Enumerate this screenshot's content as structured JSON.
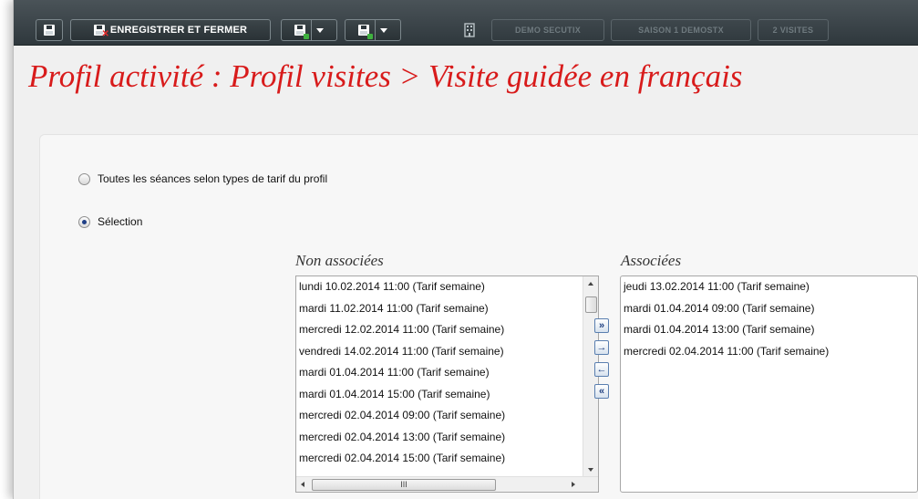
{
  "toolbar": {
    "save_and_close_label": "ENREGISTRER ET FERMER",
    "breadcrumb": [
      "DEMO SECUTIX",
      "SAISON 1 DEMOSTX",
      "2 VISITES"
    ]
  },
  "page": {
    "title": "Profil activité : Profil visites > Visite guidée en français"
  },
  "options": {
    "all_sessions_label": "Toutes les séances selon types de tarif du profil",
    "selection_label": "Sélection",
    "selected": "selection"
  },
  "lists": {
    "unassociated_title": "Non associées",
    "associated_title": "Associées",
    "unassociated": [
      "lundi 10.02.2014 11:00 (Tarif semaine)",
      "mardi 11.02.2014 11:00 (Tarif semaine)",
      "mercredi 12.02.2014 11:00 (Tarif semaine)",
      "vendredi 14.02.2014 11:00 (Tarif semaine)",
      "mardi 01.04.2014 11:00 (Tarif semaine)",
      "mardi 01.04.2014 15:00 (Tarif semaine)",
      "mercredi 02.04.2014 09:00 (Tarif semaine)",
      "mercredi 02.04.2014 13:00 (Tarif semaine)",
      "mercredi 02.04.2014 15:00 (Tarif semaine)"
    ],
    "associated": [
      "jeudi 13.02.2014 11:00 (Tarif semaine)",
      "mardi 01.04.2014 09:00 (Tarif semaine)",
      "mardi 01.04.2014 13:00 (Tarif semaine)",
      "mercredi 02.04.2014 11:00 (Tarif semaine)"
    ]
  },
  "icons": {
    "save": "save-icon",
    "save_close": "save-close-icon",
    "save_new": "save-new-icon",
    "building": "building-icon",
    "move_all_right": "move-all-right-icon",
    "move_right": "move-right-icon",
    "move_left": "move-left-icon",
    "move_all_left": "move-all-left-icon"
  },
  "colors": {
    "title": "#d81b1b",
    "toolbar": "#2f383d"
  }
}
